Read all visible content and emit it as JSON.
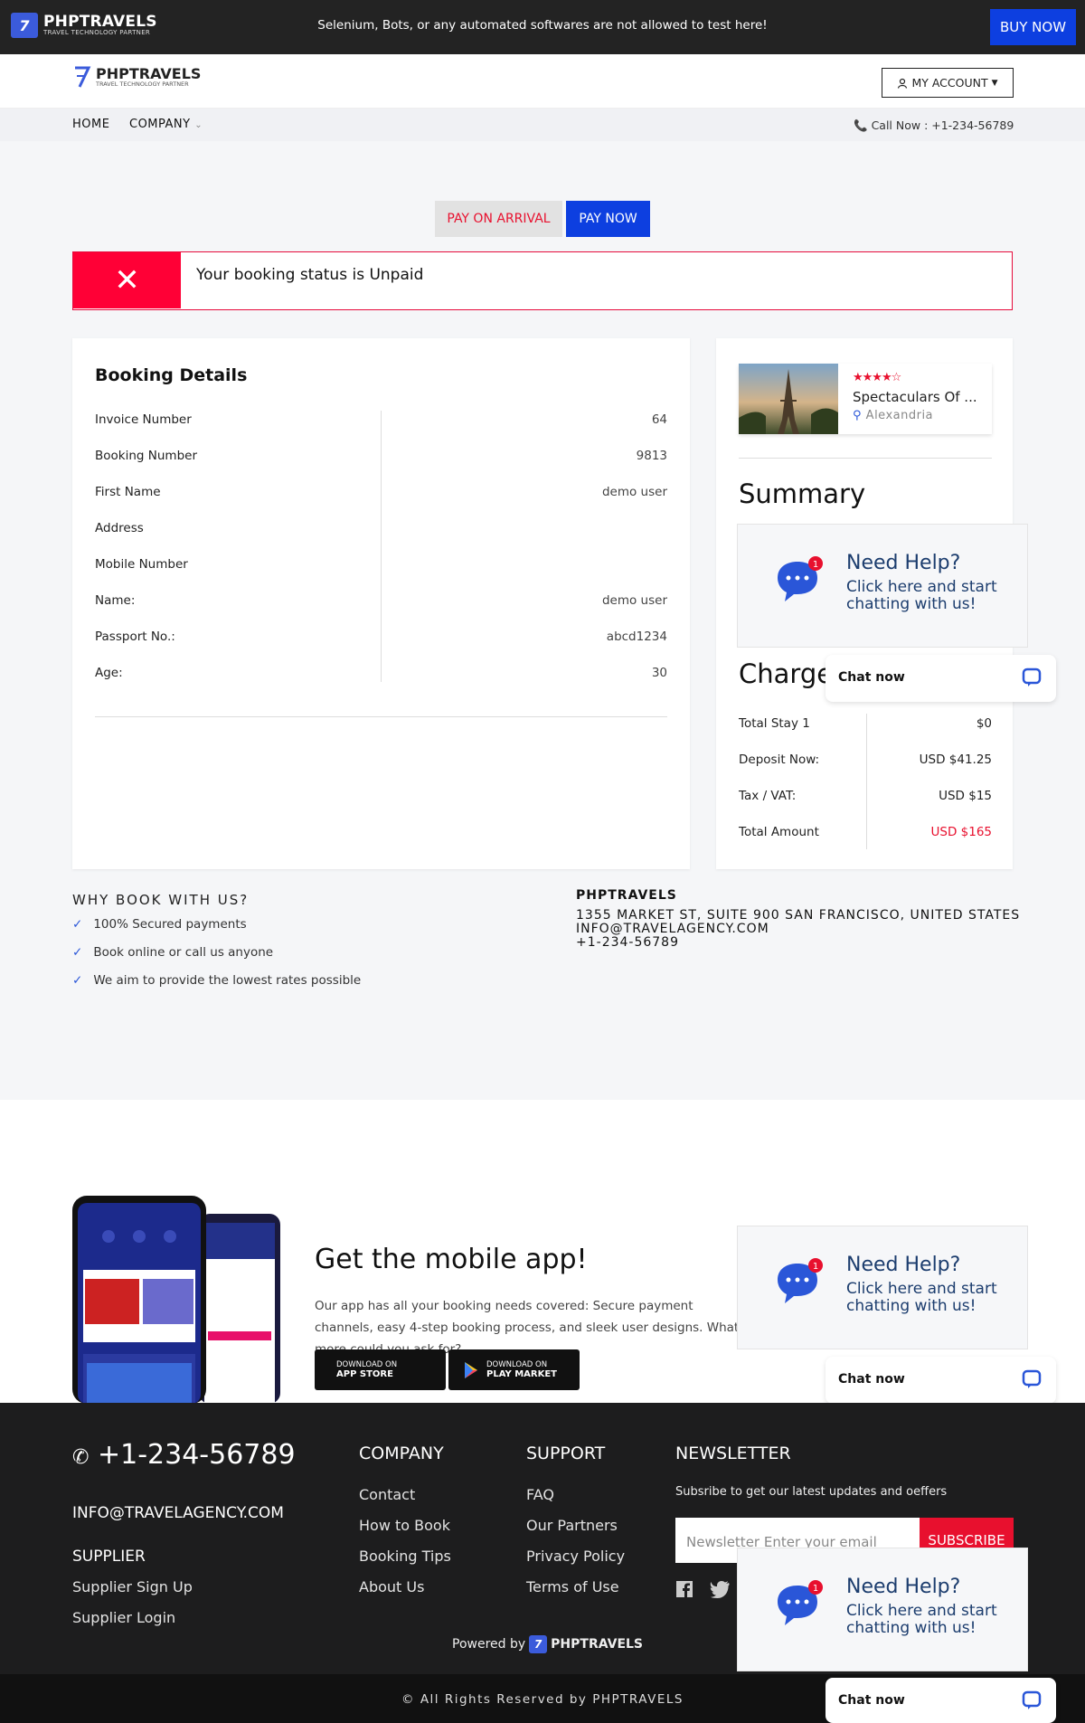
{
  "topbar": {
    "logo": "PHPTRAVELS",
    "logo_sub": "TRAVEL TECHNOLOGY PARTNER",
    "notice": "Selenium, Bots, or any automated softwares are not allowed to test here!",
    "buy_now": "BUY NOW"
  },
  "nav": {
    "logo": "PHPTRAVELS",
    "logo_sub": "TRAVEL TECHNOLOGY PARTNER",
    "account": "MY ACCOUNT",
    "home": "HOME",
    "company": "COMPANY",
    "call": "Call Now : +1-234-56789"
  },
  "payment": {
    "pay_on_arrival": "PAY ON ARRIVAL",
    "pay_now": "PAY NOW"
  },
  "alert": {
    "icon": "x-icon",
    "message": "Your booking status is Unpaid",
    "color": "#ff0036"
  },
  "booking": {
    "title": "Booking Details",
    "rows": [
      {
        "label": "Invoice Number",
        "value": "64"
      },
      {
        "label": "Booking Number",
        "value": "9813"
      },
      {
        "label": "First Name",
        "value": "demo user"
      },
      {
        "label": "Address",
        "value": ""
      },
      {
        "label": "Mobile Number",
        "value": ""
      },
      {
        "label": "Name:",
        "value": "demo user"
      },
      {
        "label": "Passport No.:",
        "value": "abcd1234"
      },
      {
        "label": "Age:",
        "value": "30"
      }
    ]
  },
  "summary": {
    "hotel": {
      "stars": 4,
      "stars_text": "★★★★☆",
      "name": "Spectaculars Of ...",
      "location": "Alexandria"
    },
    "title": "Summary",
    "charges_title": "Charges",
    "charges": [
      {
        "label": "Total Stay 1",
        "value": "$0"
      },
      {
        "label": "Deposit Now:",
        "value": "USD $41.25"
      },
      {
        "label": "Tax / VAT:",
        "value": "USD $15"
      },
      {
        "label": "Total Amount",
        "value": "USD $165"
      }
    ]
  },
  "help": {
    "title": "Need Help?",
    "text": "Click here and start chatting with us!",
    "badge": "1",
    "chat": "Chat now"
  },
  "why": {
    "title": "WHY BOOK WITH US?",
    "items": [
      "100% Secured payments",
      "Book online or call us anyone",
      "We aim to provide the lowest rates possible"
    ]
  },
  "company": {
    "name": "PHPTRAVELS",
    "address": "1355 MARKET ST, SUITE 900 SAN FRANCISCO, UNITED STATES",
    "email": "INFO@TRAVELAGENCY.COM",
    "phone": "+1-234-56789"
  },
  "mobile": {
    "title": "Get the mobile app!",
    "text": "Our app has all your booking needs covered: Secure payment channels, easy 4-step booking process, and sleek user designs. What more could you ask for?",
    "app_store_top": "DOWNLOAD ON",
    "app_store": "APP STORE",
    "play_top": "DOWNLOAD ON",
    "play": "PLAY MARKET"
  },
  "footer": {
    "phone": "+1-234-56789",
    "email": "INFO@TRAVELAGENCY.COM",
    "supplier": {
      "title": "SUPPLIER",
      "links": [
        "Supplier Sign Up",
        "Supplier Login"
      ]
    },
    "company": {
      "title": "COMPANY",
      "links": [
        "Contact",
        "How to Book",
        "Booking Tips",
        "About Us"
      ]
    },
    "support": {
      "title": "SUPPORT",
      "links": [
        "FAQ",
        "Our Partners",
        "Privacy Policy",
        "Terms of Use"
      ]
    },
    "newsletter": {
      "title": "NEWSLETTER",
      "subtitle": "Subsribe to get our latest updates and oeffers",
      "placeholder": "Newsletter Enter your email",
      "button": "SUBSCRIBE"
    },
    "powered": "Powered by",
    "powered_brand": "PHPTRAVELS",
    "copyright": "© All Rights Reserved by PHPTRAVELS"
  },
  "colors": {
    "accent": "#0d3fe0",
    "danger": "#e8102e",
    "dark": "#1d1d1e"
  }
}
